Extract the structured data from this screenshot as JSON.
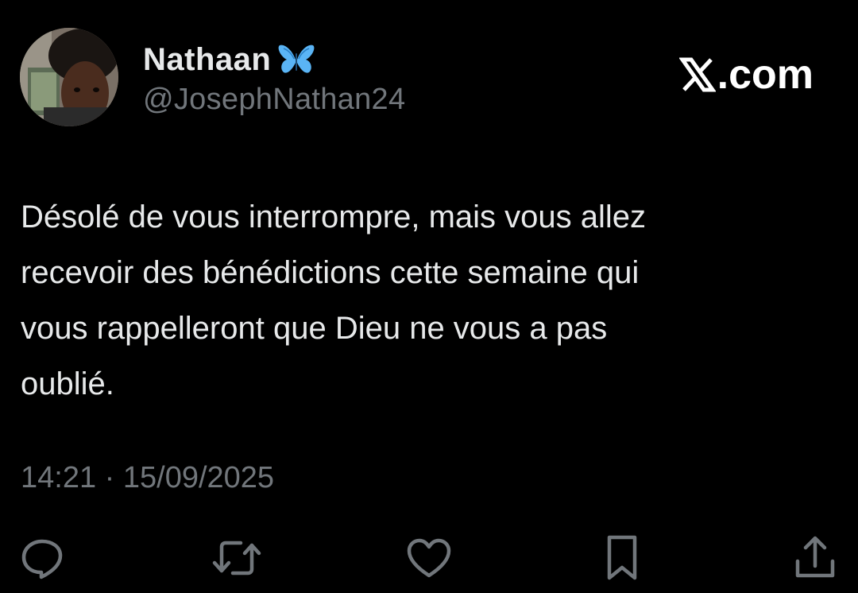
{
  "author": {
    "display_name": "Nathaan",
    "handle": "@JosephNathan24",
    "badge_icon": "butterfly-icon",
    "badge_color": "#5ab4f5"
  },
  "brand": {
    "logo_icon": "x-logo-icon",
    "suffix": ".com"
  },
  "tweet": {
    "lines": [
      "Désolé de vous interrompre, mais vous allez",
      "recevoir des bénédictions cette semaine qui",
      "vous rappelleront que Dieu ne vous a pas",
      "oublié."
    ],
    "time": "14:21",
    "separator": " · ",
    "date": "15/09/2025"
  },
  "actions": [
    {
      "icon": "reply-icon"
    },
    {
      "icon": "retweet-icon"
    },
    {
      "icon": "like-icon"
    },
    {
      "icon": "bookmark-icon"
    },
    {
      "icon": "share-icon"
    }
  ],
  "colors": {
    "background": "#000000",
    "primary_text": "#e7e9ea",
    "secondary_text": "#71767b"
  }
}
